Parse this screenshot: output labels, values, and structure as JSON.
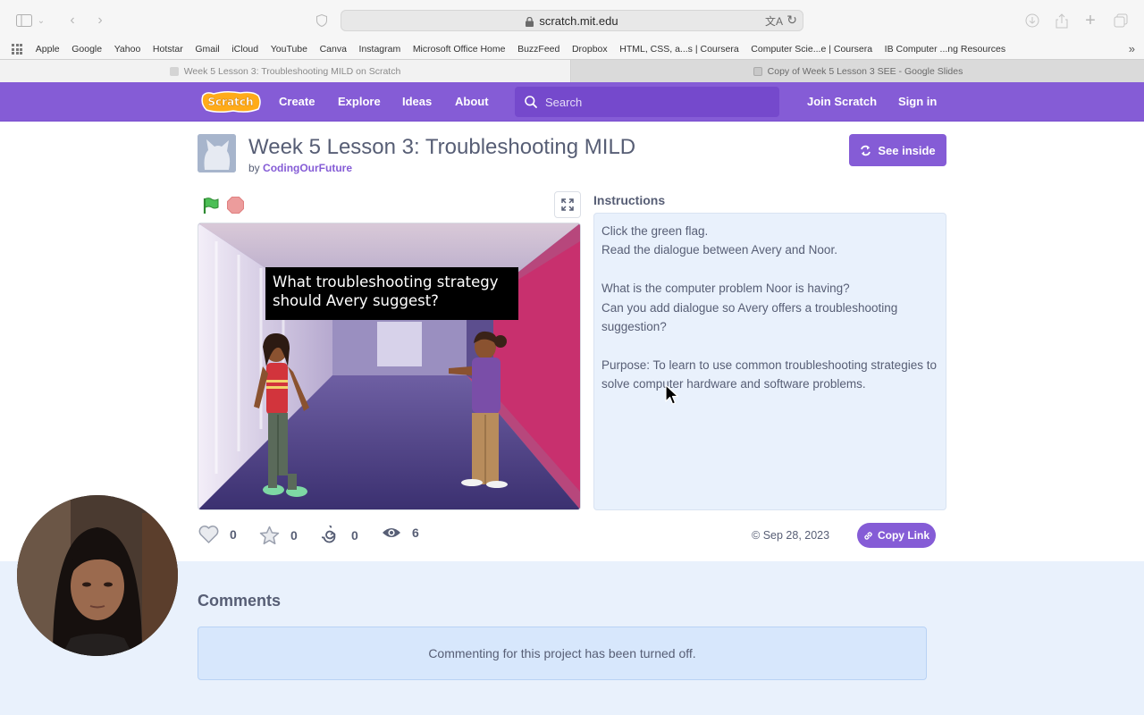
{
  "browser": {
    "url": "scratch.mit.edu",
    "favorites": [
      "Apple",
      "Google",
      "Yahoo",
      "Hotstar",
      "Gmail",
      "iCloud",
      "YouTube",
      "Canva",
      "Instagram",
      "Microsoft Office Home",
      "BuzzFeed",
      "Dropbox",
      "HTML, CSS, a...s | Coursera",
      "Computer Scie...e | Coursera",
      "IB Computer ...ng Resources"
    ],
    "tabs": [
      {
        "title": "Week 5 Lesson 3: Troubleshooting MILD on Scratch",
        "active": true
      },
      {
        "title": "Copy of Week 5 Lesson 3 SEE - Google Slides",
        "active": false
      }
    ]
  },
  "nav": {
    "logo_text": "Scratch",
    "links": [
      "Create",
      "Explore",
      "Ideas",
      "About"
    ],
    "search_placeholder": "Search",
    "join": "Join Scratch",
    "signin": "Sign in",
    "brand_color": "#855cd6"
  },
  "project": {
    "title": "Week 5 Lesson 3: Troubleshooting MILD",
    "by": "by",
    "author": "CodingOurFuture",
    "see_inside": "See inside",
    "stage_caption": "What troubleshooting strategy should Avery suggest?",
    "instructions_heading": "Instructions",
    "instructions": [
      "Click the green flag.",
      "Read the dialogue between Avery and Noor.",
      "",
      "What is the computer problem Noor is having?",
      "Can you add dialogue so Avery offers a troubleshooting suggestion?",
      "",
      "Purpose: To learn to use common troubleshooting strategies to solve computer hardware and software problems."
    ],
    "stats": {
      "loves": "0",
      "favorites": "0",
      "remixes": "0",
      "views": "6"
    },
    "date": "Sep 28, 2023",
    "copy_link": "Copy Link"
  },
  "comments": {
    "title": "Comments",
    "message": "Commenting for this project has been turned off."
  }
}
